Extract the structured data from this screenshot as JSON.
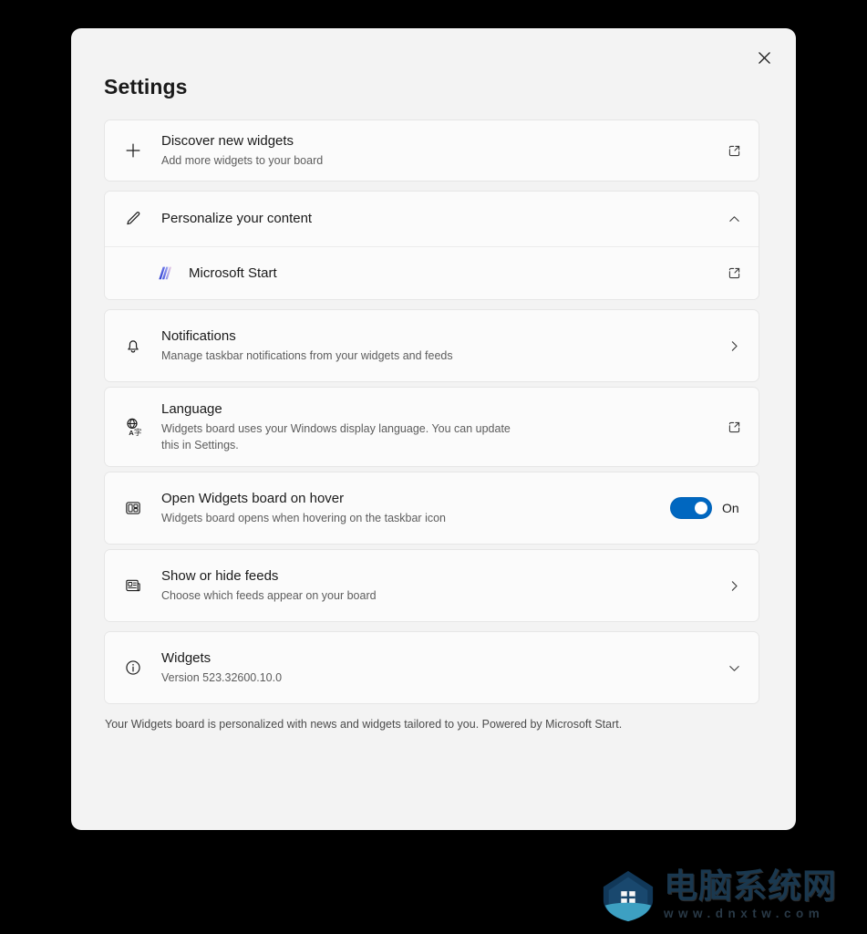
{
  "window": {
    "title": "Settings",
    "close_label": "Close"
  },
  "items": [
    {
      "icon": "plus-icon",
      "title": "Discover new widgets",
      "subtitle": "Add more widgets to your board",
      "end": "open-external-icon"
    },
    {
      "icon": "pencil-icon",
      "title": "Personalize your content",
      "subtitle": "",
      "end": "chevron-up-icon"
    },
    {
      "icon": "microsoft-start-logo",
      "title": "Microsoft Start",
      "subtitle": "",
      "end": "open-external-icon"
    },
    {
      "icon": "bell-icon",
      "title": "Notifications",
      "subtitle": "Manage taskbar notifications from your widgets and feeds",
      "end": "chevron-right-icon"
    },
    {
      "icon": "language-globe-icon",
      "title": "Language",
      "subtitle": "Widgets board uses your Windows display language. You can update this in Settings.",
      "end": "open-external-icon"
    },
    {
      "icon": "widgets-board-icon",
      "title": "Open Widgets board on hover",
      "subtitle": "Widgets board opens when hovering on the taskbar icon",
      "end": "toggle",
      "toggle_state": "On"
    },
    {
      "icon": "feeds-icon",
      "title": "Show or hide feeds",
      "subtitle": "Choose which feeds appear on your board",
      "end": "chevron-right-icon"
    },
    {
      "icon": "info-icon",
      "title": "Widgets",
      "subtitle": "Version 523.32600.10.0",
      "end": "chevron-down-icon"
    }
  ],
  "footer": {
    "note": "Your Widgets board is personalized with news and widgets tailored to you. Powered by Microsoft Start."
  },
  "watermark": {
    "name": "电脑系统网",
    "url": "www.dnxtw.com"
  },
  "colors": {
    "accent": "#0067c0",
    "panel_bg": "#f3f3f3",
    "card_bg": "#fbfbfb",
    "text_primary": "#1a1a1a",
    "text_secondary": "#5d5d5d",
    "backdrop": "#000000"
  }
}
